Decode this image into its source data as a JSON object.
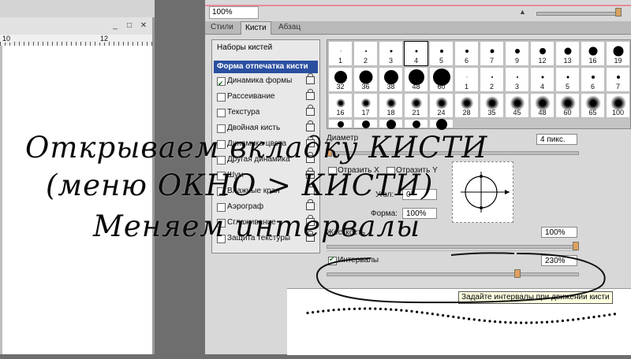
{
  "document": {
    "ruler_labels": [
      "10",
      "12"
    ]
  },
  "panel": {
    "zoom": "100%",
    "tabs": [
      {
        "label": "Стили"
      },
      {
        "label": "Кисти"
      },
      {
        "label": "Абзац"
      }
    ],
    "menu_icon": "panel-menu-icon"
  },
  "brush_list": {
    "header": "Наборы кистей",
    "items": [
      {
        "label": "Форма отпечатка кисти",
        "checked": false,
        "selected": true
      },
      {
        "label": "Динамика формы",
        "checked": true
      },
      {
        "label": "Рассеивание",
        "checked": false
      },
      {
        "label": "Текстура",
        "checked": false
      },
      {
        "label": "Двойная кисть",
        "checked": false
      },
      {
        "label": "Динамика цвета",
        "checked": false
      },
      {
        "label": "Другая динамика",
        "checked": false
      },
      {
        "label": "Шум",
        "checked": false
      },
      {
        "label": "Влажные края",
        "checked": false
      },
      {
        "label": "Аэрограф",
        "checked": false
      },
      {
        "label": "Сглаживание",
        "checked": false
      },
      {
        "label": "Защита текстуры",
        "checked": false
      }
    ]
  },
  "brush_tips": {
    "rows": [
      [
        "1",
        "2",
        "3",
        "4",
        "5",
        "6",
        "7",
        "9",
        "12",
        "13",
        "16",
        "19"
      ],
      [
        "32",
        "36",
        "38",
        "48",
        "60",
        "1",
        "2",
        "3",
        "4",
        "5",
        "6",
        "7"
      ],
      [
        "16",
        "17",
        "18",
        "21",
        "24",
        "28",
        "35",
        "45",
        "48",
        "60",
        "65",
        "100"
      ],
      [
        "",
        "",
        "",
        "",
        ""
      ]
    ],
    "selected": "4"
  },
  "settings": {
    "diameter_label": "Диаметр",
    "diameter_value": "4 пикс.",
    "flip_x": "Отразить X",
    "flip_y": "Отразить Y",
    "angle_label": "Угол:",
    "angle_value": "0°",
    "roundness_label": "Форма:",
    "roundness_value": "100%",
    "hardness_label": "Жесткость",
    "hardness_value": "100%",
    "spacing_label": "Интервалы",
    "spacing_checked": true,
    "spacing_value": "230%",
    "tooltip": "Задайте интервалы при движении кисти"
  },
  "annotation": {
    "line1": "Открываем вкладку КИСТИ",
    "line2": "(меню ОКНО > КИСТИ)",
    "line3": "Меняем интервалы"
  }
}
